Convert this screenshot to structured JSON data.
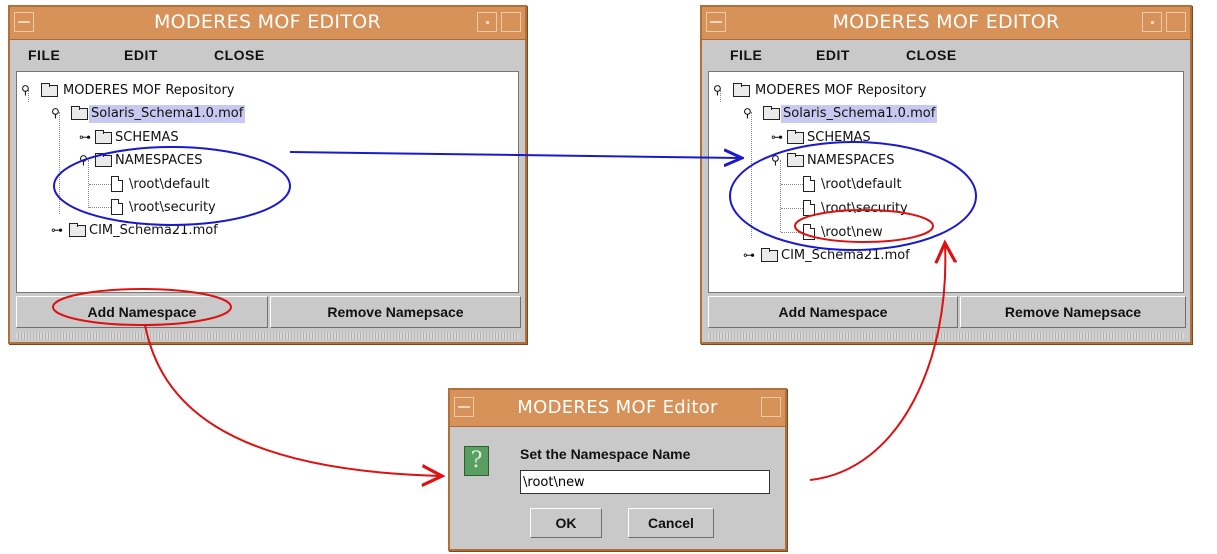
{
  "window_title": "MODERES MOF EDITOR",
  "menu": {
    "file": "FILE",
    "edit": "EDIT",
    "close": "CLOSE"
  },
  "tree": {
    "root": "MODERES MOF Repository",
    "solaris": "Solaris_Schema1.0.mof",
    "schemas": "SCHEMAS",
    "namespaces": "NAMESPACES",
    "ns_default": "\\root\\default",
    "ns_security": "\\root\\security",
    "ns_new": "\\root\\new",
    "cim": "CIM_Schema21.mof"
  },
  "buttons": {
    "add": "Add Namespace",
    "remove": "Remove Namepsace"
  },
  "dialog": {
    "title": "MODERES MOF Editor",
    "prompt": "Set the Namespace Name",
    "value": "\\root\\new",
    "ok": "OK",
    "cancel": "Cancel",
    "icon": "question-icon"
  },
  "colors": {
    "titlebar": "#d7925a",
    "highlight_blue": "#1a1acc",
    "highlight_red": "#dd1111"
  }
}
